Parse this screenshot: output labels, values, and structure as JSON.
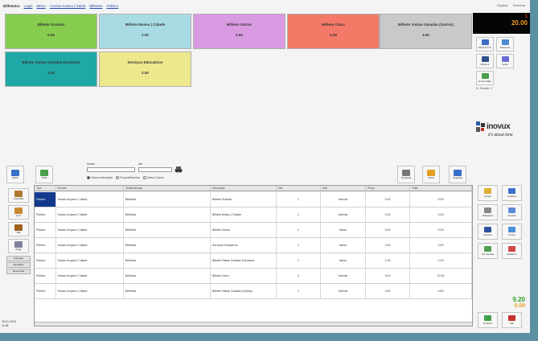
{
  "topbar": {
    "title": "Bilheteira",
    "links": [
      "Login",
      "Menu",
      "Acesso Avulso | Saída",
      "Bilhetes",
      "Público"
    ],
    "right": [
      "Opções",
      "Terminar"
    ]
  },
  "tiles": [
    {
      "label": "Bilhete Gratuito",
      "price": "0.00",
      "color": "#86cc4e"
    },
    {
      "label": "Bilhete Museu | Cidade",
      "price": "2.00",
      "color": "#a9dbe4"
    },
    {
      "label": "Bilhete Outros",
      "price": "0.00",
      "color": "#d89ae0"
    },
    {
      "label": "Bilhete Cinco",
      "price": "5.00",
      "color": "#f47a68"
    },
    {
      "label": "Bilhete Visitas Guiadas (Outros)",
      "price": "4.50",
      "color": "#c9c9c9"
    },
    {
      "label": "Bilhete Visitas Guiadas Escolares",
      "price": "1.00",
      "color": "#20a8a6"
    },
    {
      "label": "Serviços Educativos",
      "price": "2.50",
      "color": "#ede88c"
    }
  ],
  "clock": {
    "top": "1",
    "big": "20.00"
  },
  "rightpanel": {
    "buttons": [
      "Saída P.O.S.",
      "Reservas",
      "Bilhetes",
      "Ajuda",
      "Emitir Talão"
    ],
    "session": "N. Sessão: 1",
    "logo_main": "inovux",
    "logo_sub": "it's about time"
  },
  "toolbar": {
    "back": "Voltar",
    "totals": "Total",
    "from_label": "Desde",
    "to_label": "Até",
    "filters": [
      "Vistos Individuais",
      "Grupos/Escolas",
      "Vistos Outros"
    ],
    "right_buttons": [
      "Pesquisa",
      "Caixa",
      "Seguinte"
    ]
  },
  "leftcol": {
    "buttons": [
      "Consultar",
      "Livro",
      "Dia",
      "Artigo"
    ],
    "nav": [
      "Entradas",
      "Aquisição",
      "Reservado"
    ],
    "datetime": [
      "18-01-2016",
      "11:38"
    ]
  },
  "right_actions": [
    "Limpar",
    "Totalizar",
    "Bilheteira",
    "Sessão",
    "Imprimir",
    "Fundo",
    "Ver Vendas",
    "Relatório"
  ],
  "amount": {
    "main": "9.20",
    "sub": "0.00"
  },
  "bottom_buttons": [
    "Finalizar",
    "Sair"
  ],
  "table": {
    "columns": [
      "Tipo",
      "Evento",
      "Tarifa/Serviço",
      "Descrição",
      "IVA",
      "Qtd",
      "Preço",
      "Total"
    ],
    "rows": [
      [
        "Público",
        "Museu Arqueol. Cidade",
        "Bilhética",
        "Bilhete Gratuito",
        "1",
        "Normal",
        "0.00",
        "0.00"
      ],
      [
        "Público",
        "Museu Arqueol. Cidade",
        "Bilhética",
        "Bilhete Museu | Cidade",
        "1",
        "Normal",
        "2.00",
        "2.00"
      ],
      [
        "Público",
        "Museu Arqueol. Cidade",
        "Bilhética",
        "Bilhete Outros",
        "1",
        "Isento",
        "0.00",
        "0.00"
      ],
      [
        "Público",
        "Museu Arqueol. Cidade",
        "Bilhética",
        "Serviços Educativos",
        "1",
        "Isento",
        "2.50",
        "2.50"
      ],
      [
        "Público",
        "Museu Arqueol. Cidade",
        "Bilhética",
        "Bilhete Visitas Guiadas Escolares",
        "1",
        "Isento",
        "1.00",
        "1.00"
      ],
      [
        "Público",
        "Museu Arqueol. Cidade",
        "Bilhética",
        "Bilhete Cinco",
        "2",
        "Normal",
        "5.00",
        "10.00"
      ],
      [
        "Público",
        "Museu Arqueol. Cidade",
        "Bilhética",
        "Bilhete Visitas Guiadas (Outros)",
        "1",
        "Normal",
        "4.50",
        "4.50"
      ]
    ]
  }
}
